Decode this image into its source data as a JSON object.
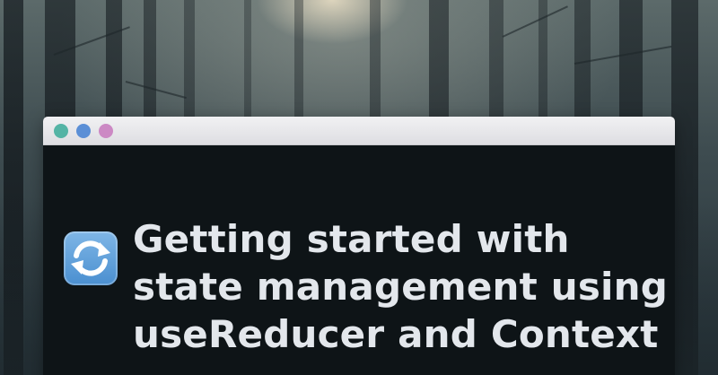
{
  "window": {
    "controls": [
      {
        "name": "close",
        "color": "#54b4a5"
      },
      {
        "name": "minimize",
        "color": "#5b8fd6"
      },
      {
        "name": "maximize",
        "color": "#cc89c4"
      }
    ]
  },
  "article": {
    "icon": "counterclockwise-arrows-icon",
    "title_lines": [
      "Getting started with",
      "state management using",
      "useReducer and Context"
    ]
  }
}
